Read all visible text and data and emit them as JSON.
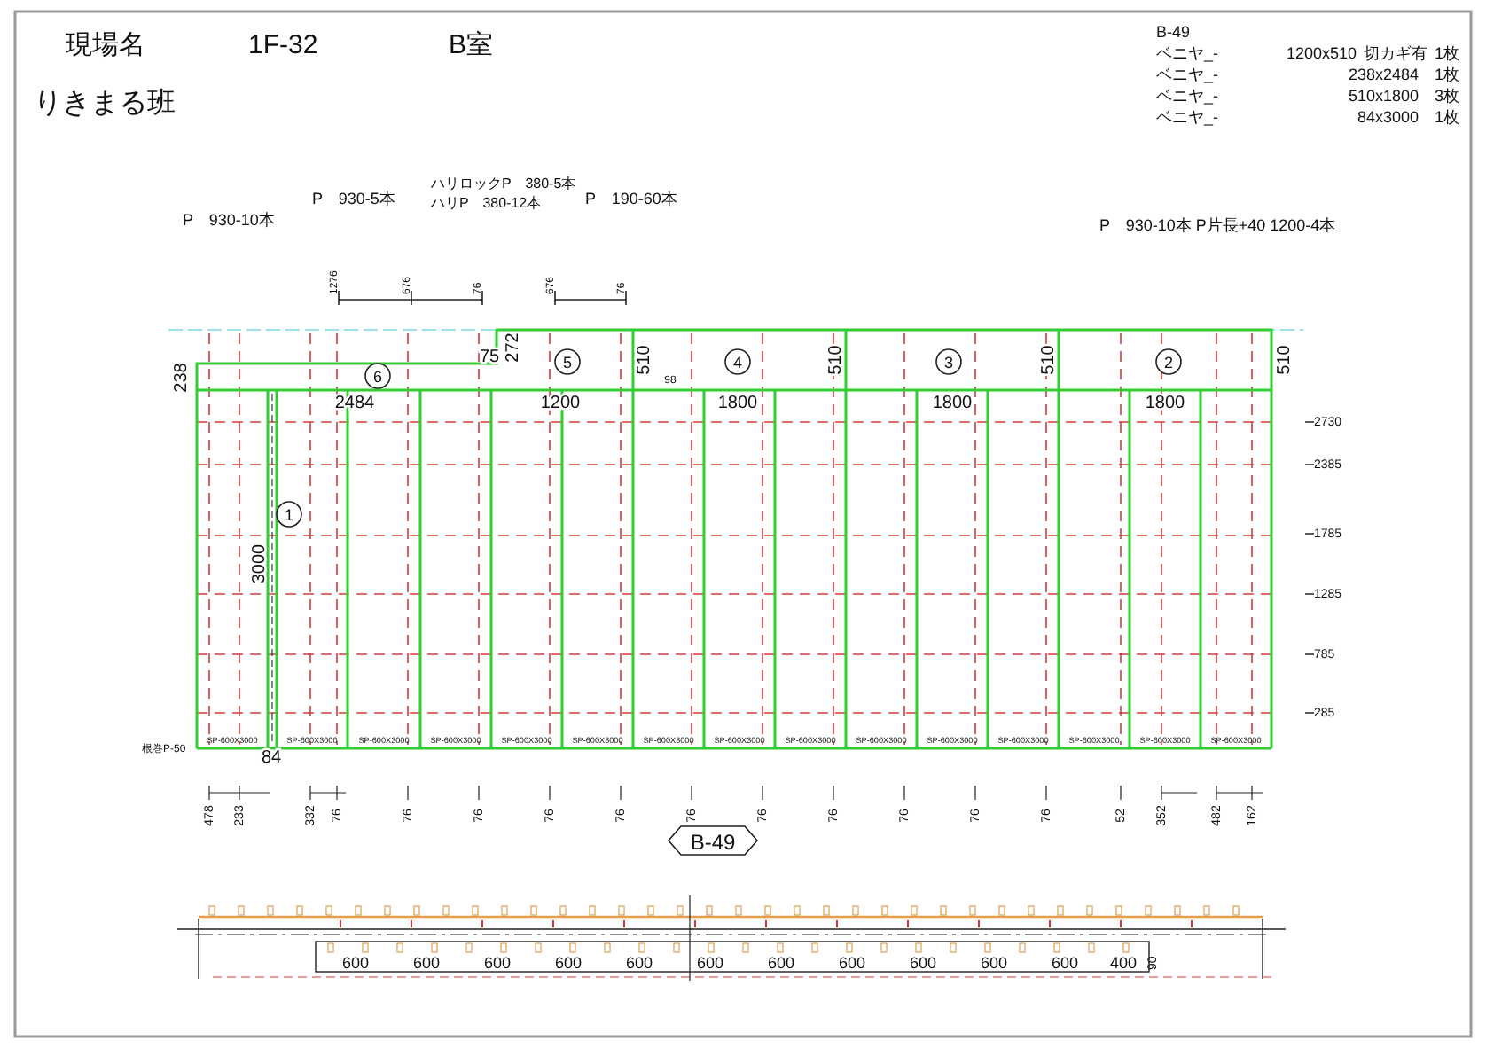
{
  "header": {
    "site_label": "現場名",
    "site": "1F-32",
    "room": "B室",
    "team": "りきまる班"
  },
  "parts_list": {
    "id": "B-49",
    "rows": [
      {
        "name": "ベニヤ_-",
        "size": "1200x510",
        "note": "切カギ有",
        "qty": "1枚"
      },
      {
        "name": "ベニヤ_-",
        "size": "238x2484",
        "qty": "1枚"
      },
      {
        "name": "ベニヤ_-",
        "size": "510x1800",
        "qty": "3枚"
      },
      {
        "name": "ベニヤ_-",
        "size": "84x3000",
        "qty": "1枚"
      }
    ]
  },
  "pipe_notes": [
    "P　930-10本",
    "P　930-5本",
    "ハリロックP　380-5本",
    "ハリP　380-12本",
    "P　190-60本",
    "P　930-10本  P片長+40  1200-4本"
  ],
  "top_dimensions": [
    "1276",
    "676",
    "76",
    "676",
    "76"
  ],
  "panel_numbers": [
    "6",
    "5",
    "4",
    "3",
    "2",
    "1"
  ],
  "panel_dimensions": [
    "238",
    "2484",
    "75",
    "272",
    "1200",
    "510",
    "98",
    "1800",
    "510",
    "1800",
    "510",
    "1800",
    "510",
    "3000",
    "84"
  ],
  "left_label": "根巻P-50",
  "level_dimensions": [
    "2730",
    "2385",
    "1785",
    "1285",
    "785",
    "285"
  ],
  "panel_tags": [
    "SP-600X3000",
    "SP-600X3000",
    "SP-600X3000",
    "SP-600X3000",
    "SP-600X3000",
    "SP-600X3000",
    "SP-600X3000",
    "SP-600X3000",
    "SP-600X3000",
    "SP-600X3000",
    "SP-600X3000",
    "SP-600X3000",
    "SP-600X3000",
    "SP-600X3000",
    "SP-600X3000"
  ],
  "bottom_dimensions": [
    "478",
    "233",
    "332",
    "76",
    "76",
    "76",
    "76",
    "76",
    "76",
    "76",
    "76",
    "76",
    "76",
    "76",
    "52",
    "352",
    "482",
    "162"
  ],
  "view_tag": "B-49",
  "section_dimensions": [
    "600",
    "600",
    "600",
    "600",
    "600",
    "600",
    "600",
    "600",
    "600",
    "600",
    "600",
    "400",
    "90"
  ]
}
